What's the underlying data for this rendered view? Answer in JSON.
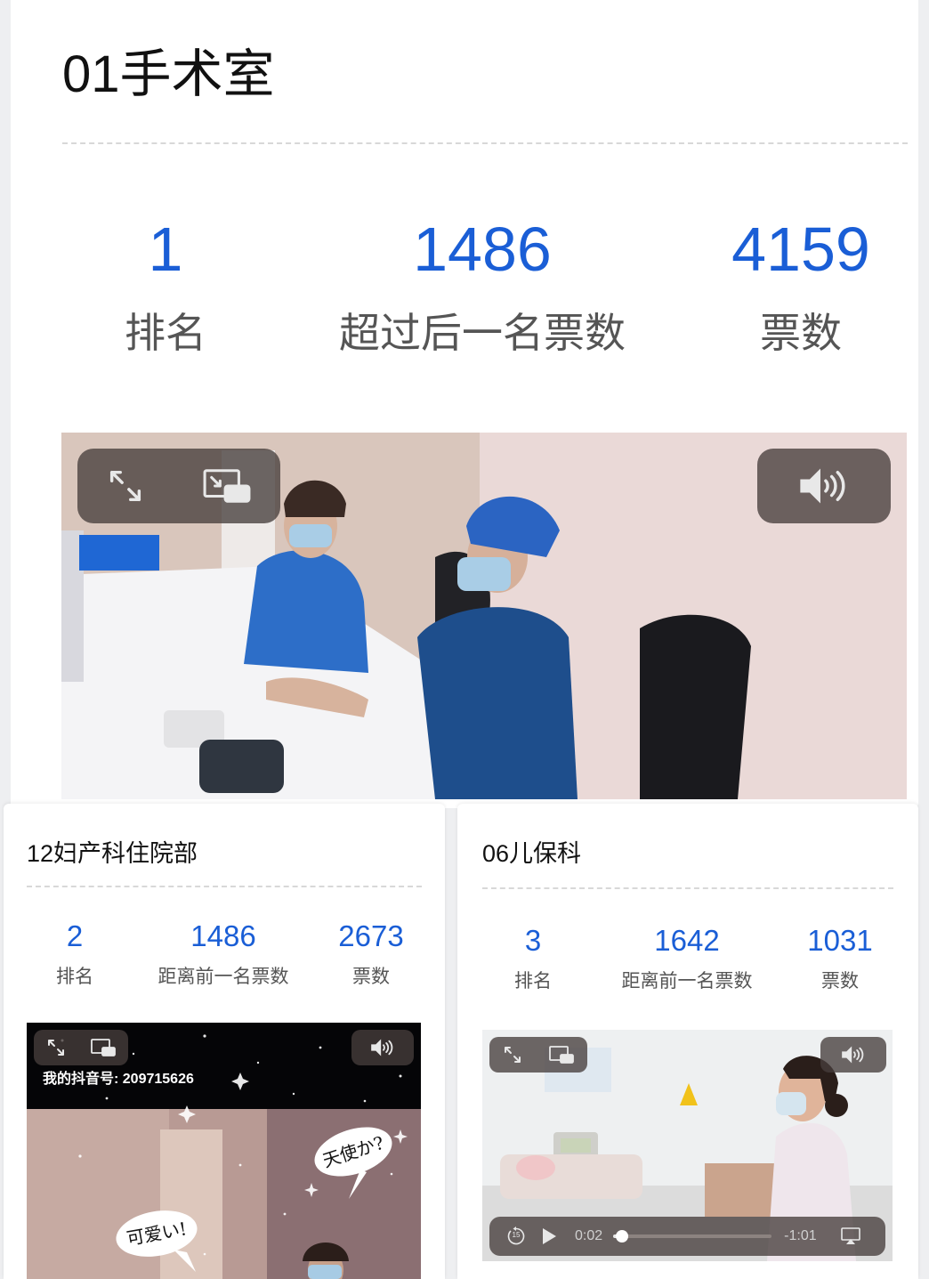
{
  "main": {
    "title": "01手术室",
    "stats": [
      {
        "value": "1",
        "label": "排名"
      },
      {
        "value": "1486",
        "label": "超过后一名票数"
      },
      {
        "value": "4159",
        "label": "票数"
      }
    ]
  },
  "cards": [
    {
      "title": "12妇产科住院部",
      "stats": [
        {
          "value": "2",
          "label": "排名"
        },
        {
          "value": "1486",
          "label": "距离前一名票数"
        },
        {
          "value": "2673",
          "label": "票数"
        }
      ],
      "video": {
        "watermark": "我的抖音号: 209715626",
        "bubble_top": "天使か?",
        "bubble_bottom": "可爱い!"
      }
    },
    {
      "title": "06儿保科",
      "stats": [
        {
          "value": "3",
          "label": "排名"
        },
        {
          "value": "1642",
          "label": "距离前一名票数"
        },
        {
          "value": "1031",
          "label": "票数"
        }
      ],
      "video": {
        "elapsed": "0:02",
        "remaining": "-1:01",
        "skip_back_seconds": "15",
        "progress": 0.04
      }
    }
  ],
  "colors": {
    "accent": "#1a5ed6",
    "label": "#555555",
    "divider": "#d8d8d8",
    "control_bg": "#463e3c"
  },
  "icons": [
    "fullscreen-icon",
    "picture-in-picture-icon",
    "volume-icon",
    "skip-back-15-icon",
    "play-icon",
    "airplay-icon"
  ]
}
